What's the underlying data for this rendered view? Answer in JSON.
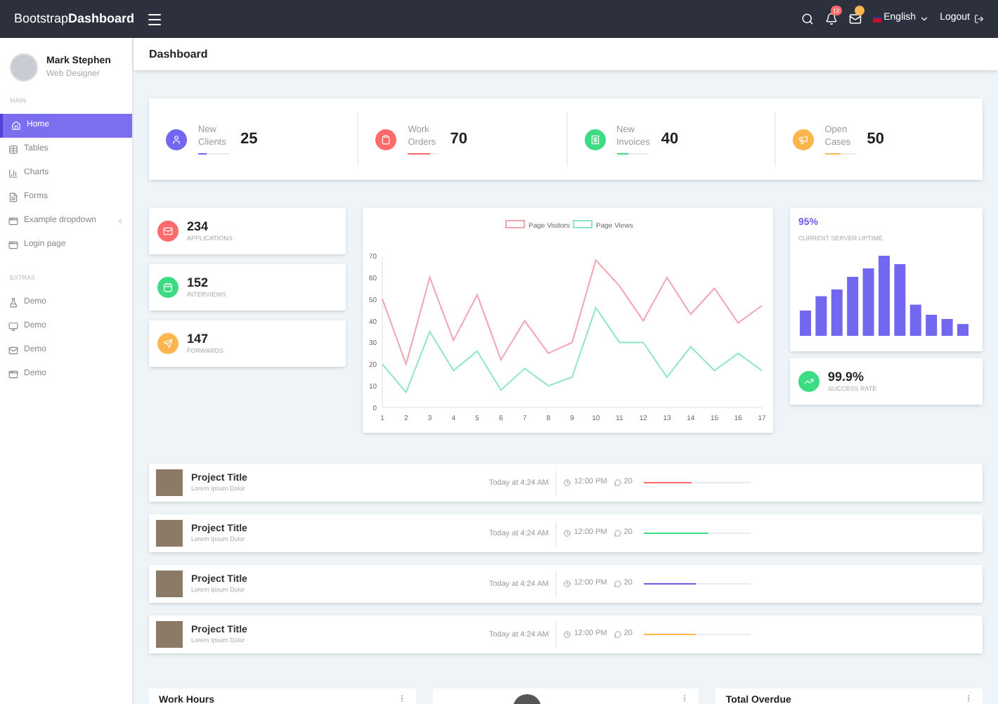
{
  "topbar": {
    "brand": "Bootstrap**Dashboard**",
    "notifications_badge": "12",
    "language": "English",
    "logout": "Logout"
  },
  "user": {
    "name": "Mark Stephen",
    "role": "Web Designer"
  },
  "sidebar": {
    "sections": [
      {
        "title": "MAIN",
        "items": [
          {
            "label": "Home",
            "selected": true,
            "dropdown": false
          },
          {
            "label": "Tables",
            "selected": false,
            "dropdown": false
          },
          {
            "label": "Charts",
            "selected": false,
            "dropdown": false
          },
          {
            "label": "Forms",
            "selected": false,
            "dropdown": false
          },
          {
            "label": "Example dropdown",
            "selected": false,
            "dropdown": true
          },
          {
            "label": "Login page",
            "selected": false,
            "dropdown": false
          }
        ]
      },
      {
        "title": "EXTRAS",
        "items": [
          {
            "label": "Demo",
            "selected": false,
            "dropdown": false
          },
          {
            "label": "Demo",
            "selected": false,
            "dropdown": false
          },
          {
            "label": "Demo",
            "selected": false,
            "dropdown": false
          },
          {
            "label": "Demo",
            "selected": false,
            "dropdown": false
          }
        ]
      }
    ]
  },
  "page_title": "Dashboard",
  "stats": [
    {
      "line1": "New",
      "line2": "Clients",
      "value": "25",
      "color": "#7367f0",
      "level": 0.25
    },
    {
      "line1": "Work",
      "line2": "Orders",
      "value": "70",
      "color": "#ff6b6b",
      "level": 0.7
    },
    {
      "line1": "New",
      "line2": "Invoices",
      "value": "40",
      "color": "#3ddc84",
      "level": 0.4
    },
    {
      "line1": "Open",
      "line2": "Cases",
      "value": "50",
      "color": "#fdb54e",
      "level": 0.5
    }
  ],
  "mini_cards": [
    {
      "value": "234",
      "label": "APPLICATIONS",
      "color": "#ff6b6b"
    },
    {
      "value": "152",
      "label": "INTERVIEWS",
      "color": "#3ddc84"
    },
    {
      "value": "147",
      "label": "FORWARDS",
      "color": "#fdb54e"
    }
  ],
  "chart": {
    "chart_data": {
      "type": "line",
      "legend": "top",
      "x": [
        1,
        2,
        3,
        4,
        5,
        6,
        7,
        8,
        9,
        10,
        11,
        12,
        13,
        14,
        15,
        16,
        17
      ],
      "xlim": [
        1,
        17
      ],
      "ylim": [
        0,
        70
      ],
      "yticks": [
        0,
        10,
        20,
        30,
        40,
        50,
        60,
        70
      ],
      "xticks": [
        1,
        2,
        3,
        4,
        5,
        6,
        7,
        8,
        9,
        10,
        11,
        12,
        13,
        14,
        15,
        16,
        17
      ],
      "series": [
        {
          "name": "Page Visitors",
          "color": "#f0a5b0",
          "values": [
            50,
            20,
            60,
            31,
            52,
            22,
            40,
            25,
            30,
            68,
            56,
            40,
            60,
            43,
            55,
            39,
            47
          ]
        },
        {
          "name": "Page Views",
          "color": "#8ee6c4",
          "values": [
            20,
            7,
            35,
            17,
            26,
            8,
            18,
            10,
            14,
            46,
            30,
            30,
            14,
            28,
            17,
            25,
            17
          ]
        }
      ]
    }
  },
  "uptime": {
    "value": "95%",
    "label": "CURRENT SERVER UPTIME"
  },
  "success": {
    "value": "99.9%",
    "label": "SUCCESS RATE"
  },
  "projects": [
    {
      "title": "Project Title",
      "subtitle": "Lorem Ipsum Dolor",
      "date": "Today at 4:24 AM",
      "time": "12:00 PM",
      "comments": "20",
      "color": "#ff6b6b",
      "level": 0.45
    },
    {
      "title": "Project Title",
      "subtitle": "Lorem Ipsum Dolor",
      "date": "Today at 4:24 AM",
      "time": "12:00 PM",
      "comments": "20",
      "color": "#3ddc84",
      "level": 0.6
    },
    {
      "title": "Project Title",
      "subtitle": "Lorem Ipsum Dolor",
      "date": "Today at 4:24 AM",
      "time": "12:00 PM",
      "comments": "20",
      "color": "#6c5ce7",
      "level": 0.49
    },
    {
      "title": "Project Title",
      "subtitle": "Lorem Ipsum Dolor",
      "date": "Today at 4:24 AM",
      "time": "12:00 PM",
      "comments": "20",
      "color": "#fdb54e",
      "level": 0.49
    }
  ],
  "bottom_cards": [
    {
      "kind": "titled",
      "title": "Work Hours"
    },
    {
      "kind": "avatar"
    },
    {
      "kind": "titled",
      "title": "Total Overdue"
    }
  ]
}
